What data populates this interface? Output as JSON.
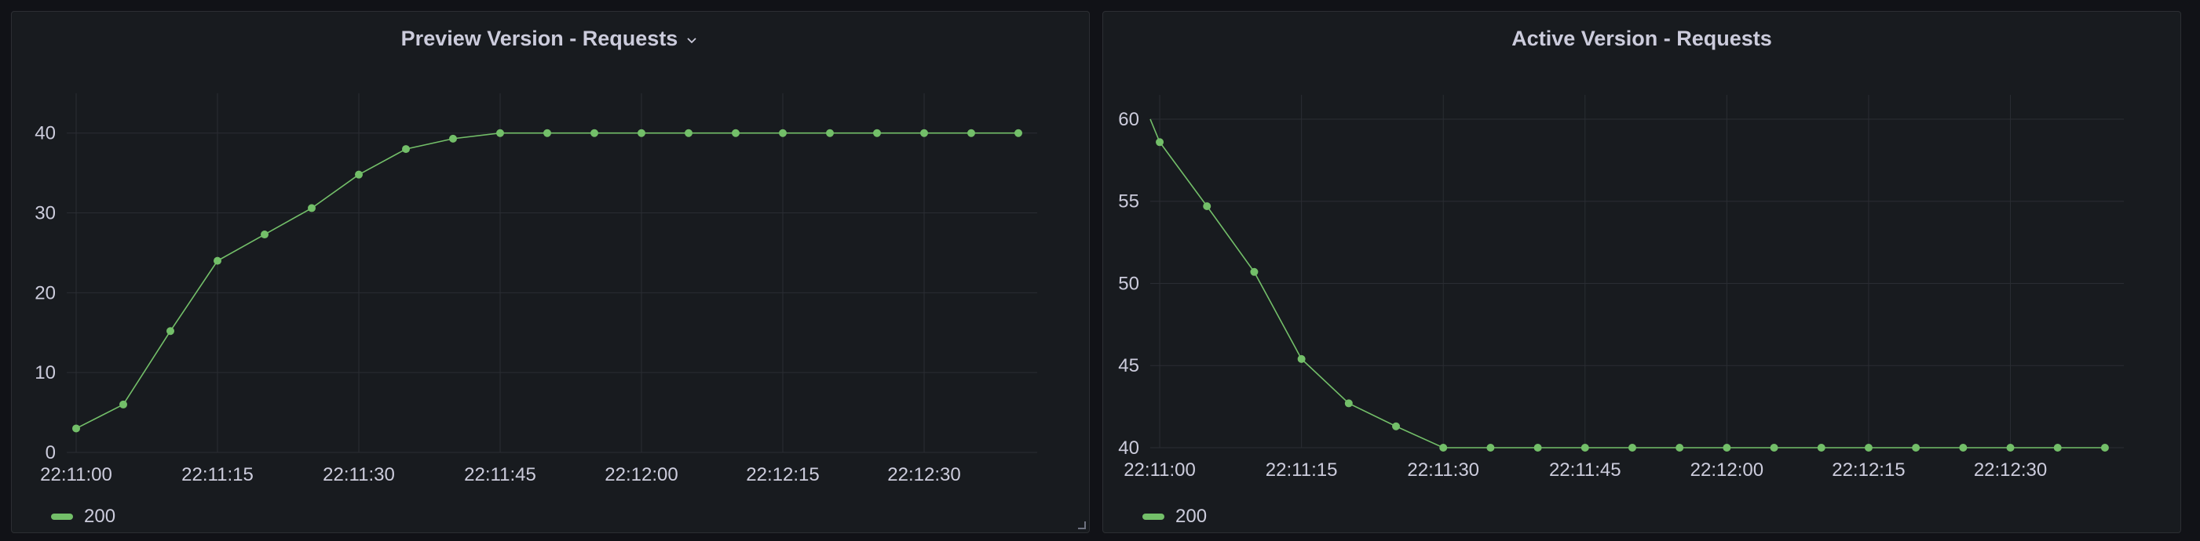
{
  "colors": {
    "series": "#73bf69",
    "grid": "#2a2d33",
    "tick": "#ccccdc"
  },
  "panels": [
    {
      "title": "Preview Version - Requests",
      "legend_label": "200",
      "has_menu_chevron": true
    },
    {
      "title": "Active Version - Requests",
      "legend_label": "200",
      "has_menu_chevron": false
    }
  ],
  "chart_data": [
    {
      "type": "line",
      "x_tick_labels": [
        "22:11:00",
        "22:11:15",
        "22:11:30",
        "22:11:45",
        "22:12:00",
        "22:12:15",
        "22:12:30"
      ],
      "x_tick_seconds": [
        0,
        15,
        30,
        45,
        60,
        75,
        90
      ],
      "xlim_seconds": [
        -1,
        102
      ],
      "y_ticks": [
        0,
        10,
        20,
        30,
        40
      ],
      "ylim": [
        0,
        44
      ],
      "grid": true,
      "legend_placement": "bottom-left",
      "series": [
        {
          "name": "200",
          "x_seconds": [
            0,
            5,
            10,
            15,
            20,
            25,
            30,
            35,
            40,
            45,
            50,
            55,
            60,
            65,
            70,
            75,
            80,
            85,
            90,
            95,
            100
          ],
          "values": [
            3,
            6,
            15.2,
            24,
            27.3,
            30.6,
            34.8,
            38,
            39.3,
            40,
            40,
            40,
            40,
            40,
            40,
            40,
            40,
            40,
            40,
            40,
            40
          ]
        }
      ]
    },
    {
      "type": "line",
      "x_tick_labels": [
        "22:11:00",
        "22:11:15",
        "22:11:30",
        "22:11:45",
        "22:12:00",
        "22:12:15",
        "22:12:30"
      ],
      "x_tick_seconds": [
        0,
        15,
        30,
        45,
        60,
        75,
        90
      ],
      "xlim_seconds": [
        -1,
        102
      ],
      "y_ticks": [
        40,
        45,
        50,
        55,
        60
      ],
      "ylim": [
        40,
        61
      ],
      "grid": true,
      "legend_placement": "bottom-left",
      "series": [
        {
          "name": "200",
          "x_seconds": [
            -1,
            0,
            5,
            10,
            15,
            20,
            25,
            30,
            35,
            40,
            45,
            50,
            55,
            60,
            65,
            70,
            75,
            80,
            85,
            90,
            95,
            100
          ],
          "values": [
            60,
            58.6,
            54.7,
            50.7,
            45.4,
            42.7,
            41.3,
            40,
            40,
            40,
            40,
            40,
            40,
            40,
            40,
            40,
            40,
            40,
            40,
            40,
            40,
            40
          ],
          "markers_from_index": 1
        }
      ]
    }
  ]
}
